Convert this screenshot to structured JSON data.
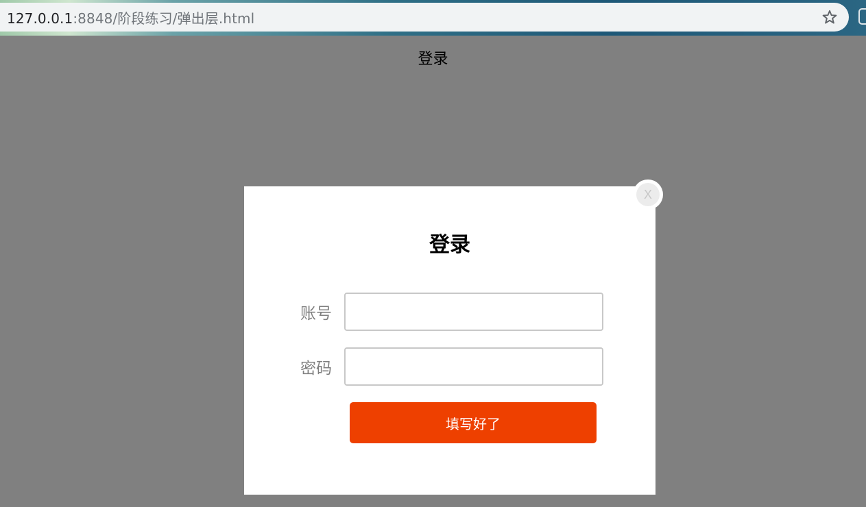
{
  "browser": {
    "url_host": "127.0.0.1",
    "url_rest": ":8848/阶段练习/弹出层.html",
    "bookmark_icon": "star-icon"
  },
  "page": {
    "title": "登录"
  },
  "dialog": {
    "close_label": "X",
    "title": "登录",
    "account_label": "账号",
    "account_value": "",
    "password_label": "密码",
    "password_value": "",
    "submit_label": "填写好了"
  },
  "colors": {
    "overlay": "#808080",
    "submit_button": "#ee4000",
    "label_text": "#808080"
  }
}
